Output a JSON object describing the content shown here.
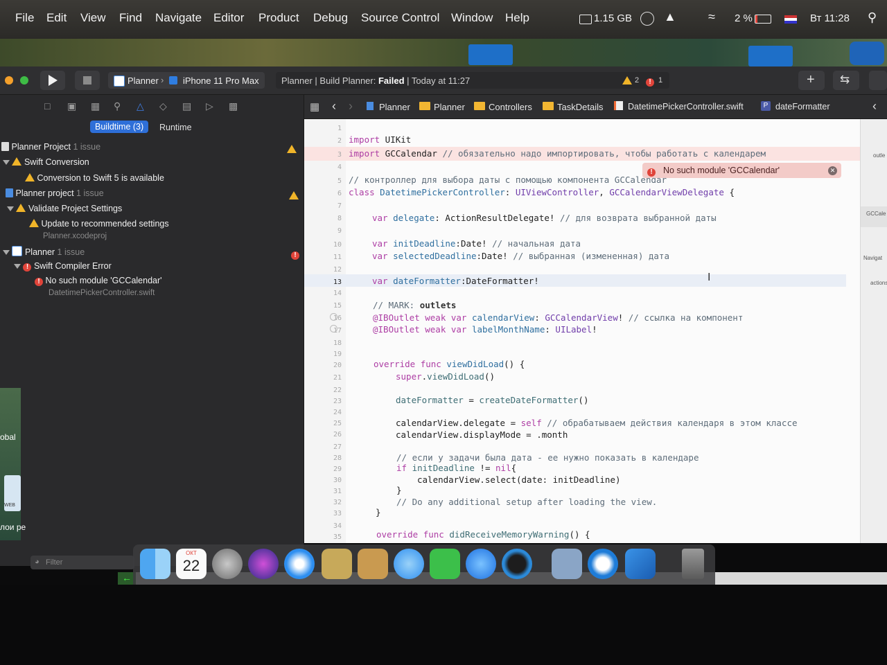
{
  "menubar": {
    "items": [
      "File",
      "Edit",
      "View",
      "Find",
      "Navigate",
      "Editor",
      "Product",
      "Debug",
      "Source Control",
      "Window",
      "Help"
    ],
    "memory": "1.15 GB",
    "battery": "2 %",
    "clock": "Вт 11:28"
  },
  "toolbar": {
    "scheme_project": "Planner",
    "scheme_device": "iPhone 11 Pro Max",
    "activity_prefix": "Planner | Build Planner: ",
    "activity_status": "Failed",
    "activity_suffix": " | Today at 11:27",
    "warning_count": "2",
    "error_count": "1"
  },
  "navigator": {
    "tabs": [
      "Buildtime (3)",
      "Runtime"
    ],
    "rows": [
      {
        "title": "Planner Project",
        "meta": "1 issue"
      },
      {
        "title": "Swift Conversion"
      },
      {
        "title": "Conversion to Swift 5 is available"
      },
      {
        "title": "Planner project",
        "meta": "1 issue"
      },
      {
        "title": "Validate Project Settings"
      },
      {
        "title": "Update to recommended settings"
      },
      {
        "title": "Planner.xcodeproj"
      },
      {
        "title": "Planner",
        "meta": "1 issue"
      },
      {
        "title": "Swift Compiler Error"
      },
      {
        "title": "No such module 'GCCalendar'"
      },
      {
        "title": "DatetimePickerController.swift"
      }
    ],
    "filter_placeholder": "Filter"
  },
  "jumpbar": [
    "Planner",
    "Planner",
    "Controllers",
    "TaskDetails",
    "DatetimePickerController.swift",
    "dateFormatter"
  ],
  "editor": {
    "error_message": "No such module 'GCCalendar'",
    "line_numbers": [
      "1",
      "2",
      "3",
      "4",
      "5",
      "6",
      "7",
      "8",
      "9",
      "10",
      "11",
      "12",
      "13",
      "14",
      "15",
      "16",
      "17",
      "18",
      "19",
      "20",
      "21",
      "22",
      "23",
      "24",
      "25",
      "26",
      "27",
      "28",
      "29",
      "30",
      "31",
      "32",
      "33",
      "34",
      "35"
    ],
    "current_line": "13"
  },
  "code": {
    "l2": {
      "kw": "import",
      "rest": " UIKit"
    },
    "l3": {
      "kw": "import",
      "rest": " GCCalendar ",
      "comment": "// обязательно надо импортировать, чтобы работать с календарем"
    },
    "l5": "// контроллер для выбора даты с помощью компонента GCCalendar",
    "l6": {
      "kw": "class",
      "name": " DatetimePickerController",
      "rest": ": ",
      "t1": "UIViewController",
      "sep": ", ",
      "t2": "GCCalendarViewDelegate",
      "end": " {"
    },
    "l8": {
      "kw": "var",
      "name": " delegate",
      "rest": ": ActionResultDelegate! ",
      "comment": "// для возврата выбранной даты"
    },
    "l10": {
      "kw": "var",
      "name": " initDeadline",
      "rest": ":Date! ",
      "comment": "// начальная дата"
    },
    "l11": {
      "kw": "var",
      "name": " selectedDeadline",
      "rest": ":Date! ",
      "comment": "// выбранная (измененная) дата"
    },
    "l13": {
      "kw": "var",
      "name": " dateFormatter",
      "rest": ":DateFormatter!"
    },
    "l15": {
      "comment": "// MARK: ",
      "bold": "outlets"
    },
    "l16": {
      "kw": "@IBOutlet weak var",
      "name": " calendarView",
      "rest": ": ",
      "t": "GCCalendarView",
      "end": "! ",
      "comment": "// ссылка на компонент"
    },
    "l17": {
      "kw": "@IBOutlet weak var",
      "name": " labelMonthName",
      "rest": ": ",
      "t": "UILabel",
      "end": "!"
    },
    "l20": {
      "kw": "override func",
      "name": " viewDidLoad",
      "rest": "() {"
    },
    "l21": {
      "kw": "super",
      "rest": ".",
      "name": "viewDidLoad",
      "end": "()"
    },
    "l23": {
      "name": "dateFormatter",
      "rest": " = ",
      "fn": "createDateFormatter",
      "end": "()"
    },
    "l25": {
      "rest": "calendarView.delegate = ",
      "kw": "self",
      "comment": " // обрабатываем действия календаря в этом классе"
    },
    "l26": "calendarView.displayMode = .month",
    "l28": "// если у задачи была дата - ее нужно показать в календаре",
    "l29": {
      "kw": "if",
      "name": " initDeadline",
      "rest": " != ",
      "kw2": "nil",
      "end": "{"
    },
    "l30": "calendarView.select(date: initDeadline)",
    "l31": "}",
    "l32": "// Do any additional setup after loading the view.",
    "l33": "}",
    "l35": {
      "kw": "override func",
      "name": " didReceiveMemoryWarning",
      "rest": "() {"
    }
  },
  "minimap": {
    "labels": [
      "outle",
      "GCCale",
      "Navigat",
      "actions"
    ]
  },
  "dock": {
    "calendar_month": "ОКТ",
    "calendar_day": "22"
  },
  "desktop_labels": [
    "obal",
    "лои pe",
    "WEB"
  ]
}
